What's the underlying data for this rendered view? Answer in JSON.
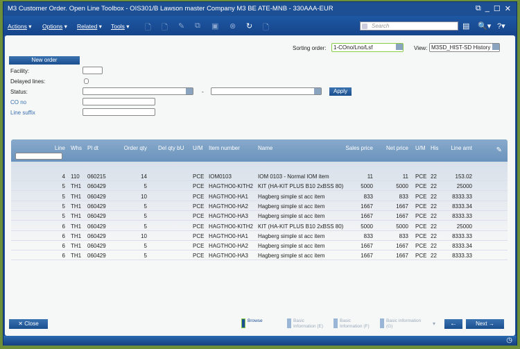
{
  "window": {
    "title": "M3 Customer Order. Open Line Toolbox - OIS301/B   Lawson master Company M3 BE ATE-MNB - 330AAA-EUR"
  },
  "menu": {
    "actions": "Actions",
    "options": "Options",
    "related": "Related",
    "tools": "Tools"
  },
  "search": {
    "placeholder": "Search"
  },
  "header": {
    "sorting_label": "Sorting order:",
    "sorting_value": "1-COno/Lno/Lsf",
    "view_label": "View:",
    "view_value": "M3SD_HIST-SD History"
  },
  "form": {
    "new_order": "New order",
    "facility": "Facility:",
    "delayed": "Delayed lines:",
    "status": "Status:",
    "dash": "-",
    "apply": "Apply",
    "co_no": "CO no",
    "line_suffix": "Line suffix"
  },
  "grid": {
    "columns": [
      "Line",
      "Whs",
      "Pl dt",
      "Order qty",
      "Del qty bU",
      "U/M",
      "Item number",
      "Name",
      "Sales price",
      "Net price",
      "U/M",
      "His",
      "Line amt"
    ],
    "rows": [
      [
        "4",
        "110",
        "060215",
        "14",
        "",
        "PCE",
        "IOM0103",
        "IOM 0103 - Normal IOM item",
        "11",
        "11",
        "PCE",
        "22",
        "153.02"
      ],
      [
        "5",
        "TH1",
        "060429",
        "5",
        "",
        "PCE",
        "HAGTHO0-KITH2",
        "KIT (HA-KIT PLUS B10 2xBSS 80)",
        "5000",
        "5000",
        "PCE",
        "22",
        "25000"
      ],
      [
        "5",
        "TH1",
        "060429",
        "10",
        "",
        "PCE",
        "HAGTHO0-HA1",
        "Hagberg simple st acc item",
        "833",
        "833",
        "PCE",
        "22",
        "8333.33"
      ],
      [
        "5",
        "TH1",
        "060429",
        "5",
        "",
        "PCE",
        "HAGTHO0-HA2",
        "Hagberg simple st acc item",
        "1667",
        "1667",
        "PCE",
        "22",
        "8333.34"
      ],
      [
        "5",
        "TH1",
        "060429",
        "5",
        "",
        "PCE",
        "HAGTHO0-HA3",
        "Hagberg simple st acc item",
        "1667",
        "1667",
        "PCE",
        "22",
        "8333.33"
      ],
      [
        "6",
        "TH1",
        "060429",
        "5",
        "",
        "PCE",
        "HAGTHO0-KITH2",
        "KIT (HA-KIT PLUS B10 2xBSS 80)",
        "5000",
        "5000",
        "PCE",
        "22",
        "25000"
      ],
      [
        "6",
        "TH1",
        "060429",
        "10",
        "",
        "PCE",
        "HAGTHO0-HA1",
        "Hagberg simple st acc item",
        "833",
        "833",
        "PCE",
        "22",
        "8333.33"
      ],
      [
        "6",
        "TH1",
        "060429",
        "5",
        "",
        "PCE",
        "HAGTHO0-HA2",
        "Hagberg simple st acc item",
        "1667",
        "1667",
        "PCE",
        "22",
        "8333.34"
      ],
      [
        "6",
        "TH1",
        "060429",
        "5",
        "",
        "PCE",
        "HAGTHO0-HA3",
        "Hagberg simple st acc item",
        "1667",
        "1667",
        "PCE",
        "22",
        "8333.33"
      ]
    ]
  },
  "footer": {
    "close": "Close",
    "browse": "Browse",
    "browse_key": "B",
    "basic_e": "Basic Information (E)",
    "basic_f": "Basic Information (F)",
    "basic_g": "Basic Information (G)",
    "next": "Next"
  }
}
